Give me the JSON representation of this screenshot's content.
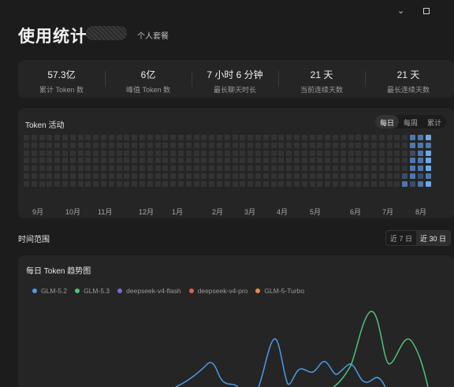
{
  "window": {
    "chevron_icon": "chevron-down-icon",
    "maximize_icon": "maximize-icon"
  },
  "header": {
    "title": "使用统计",
    "plan": "个人套餐"
  },
  "stats": [
    {
      "value": "57.3亿",
      "label": "累计 Token 数"
    },
    {
      "value": "6亿",
      "label": "峰值 Token 数"
    },
    {
      "value": "7 小时 6 分钟",
      "label": "最长聊天时长"
    },
    {
      "value": "21 天",
      "label": "当前连续天数"
    },
    {
      "value": "21 天",
      "label": "最长连续天数"
    }
  ],
  "activity": {
    "title": "Token 活动",
    "tabs": [
      "每日",
      "每周",
      "累计"
    ],
    "active_tab": "每日",
    "months": [
      "9月",
      "10月",
      "11月",
      "12月",
      "1月",
      "2月",
      "3月",
      "4月",
      "5月",
      "6月",
      "7月",
      "8月"
    ],
    "colors": {
      "empty": "#333333",
      "l1": "#3b4d66",
      "l2": "#4f77ab",
      "l3": "#6fa6e4"
    },
    "recent_levels": [
      [
        0,
        0,
        0,
        0,
        0,
        0,
        0
      ],
      [
        0,
        0,
        0,
        0,
        0,
        1,
        2
      ],
      [
        2,
        2,
        1,
        2,
        2,
        2,
        1
      ],
      [
        2,
        2,
        2,
        2,
        2,
        1,
        2
      ],
      [
        3,
        2,
        3,
        3,
        3,
        2,
        3
      ]
    ]
  },
  "range": {
    "label": "时间范围",
    "options": [
      "近 7 日",
      "近 30 日"
    ],
    "active": "近 30 日"
  },
  "chart_data": {
    "type": "line",
    "title": "每日 Token 趋势图",
    "series": [
      {
        "name": "GLM-5.2",
        "color": "#4d9be6"
      },
      {
        "name": "GLM-5.3",
        "color": "#4fc27a"
      },
      {
        "name": "deepseek-v4-flash",
        "color": "#7b68d8"
      },
      {
        "name": "deepseek-v4-pro",
        "color": "#e25c5c"
      },
      {
        "name": "GLM-5-Turbo",
        "color": "#e88a4a"
      }
    ]
  }
}
